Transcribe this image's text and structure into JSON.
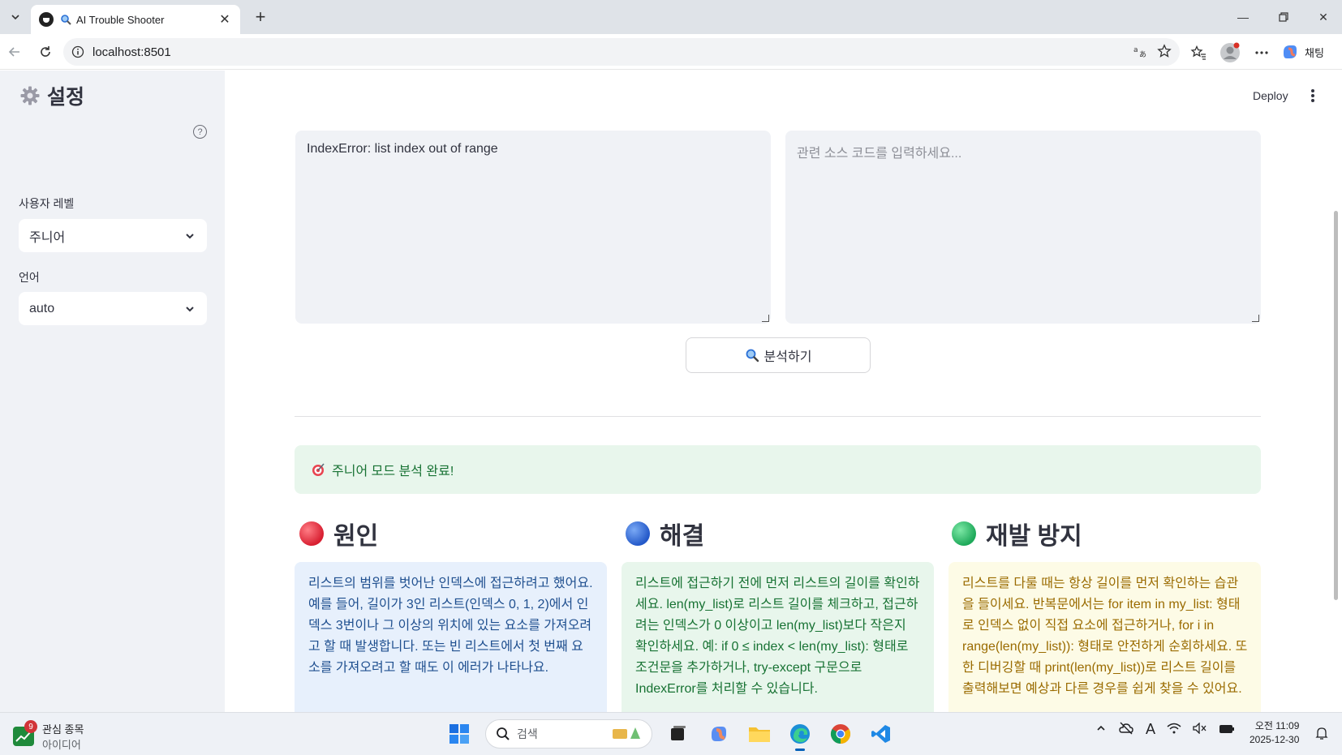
{
  "browser": {
    "tab_title": "AI Trouble Shooter",
    "url": "localhost:8501",
    "chat_label": "채팅"
  },
  "app": {
    "deploy_label": "Deploy",
    "sidebar": {
      "title": "설정",
      "user_level_label": "사용자 레벨",
      "user_level_value": "주니어",
      "language_label": "언어",
      "language_value": "auto"
    },
    "error_input_value": "IndexError: list index out of range",
    "code_input_placeholder": "관련 소스 코드를 입력하세요...",
    "analyze_button": "분석하기",
    "success_message": "주니어 모드 분석 완료!",
    "columns": [
      {
        "title": "원인",
        "dot_color": "#e0303d",
        "bg": "#e7f0fc",
        "text_color": "#1f4f8f",
        "text": "리스트의 범위를 벗어난 인덱스에 접근하려고 했어요. 예를 들어, 길이가 3인 리스트(인덱스 0, 1, 2)에서 인덱스 3번이나 그 이상의 위치에 있는 요소를 가져오려고 할 때 발생합니다. 또는 빈 리스트에서 첫 번째 요소를 가져오려고 할 때도 이 에러가 나타나요."
      },
      {
        "title": "해결",
        "dot_color": "#2f6fd6",
        "bg": "#e8f6ec",
        "text_color": "#177233",
        "text": "리스트에 접근하기 전에 먼저 리스트의 길이를 확인하세요. len(my_list)로 리스트 길이를 체크하고, 접근하려는 인덱스가 0 이상이고 len(my_list)보다 작은지 확인하세요. 예: if 0 ≤ index < len(my_list): 형태로 조건문을 추가하거나, try-except 구문으로 IndexError를 처리할 수 있습니다."
      },
      {
        "title": "재발 방지",
        "dot_color": "#2fbd6a",
        "bg": "#fdfbe6",
        "text_color": "#9a6b00",
        "text": "리스트를 다룰 때는 항상 길이를 먼저 확인하는 습관을 들이세요. 반복문에서는 for item in my_list: 형태로 인덱스 없이 직접 요소에 접근하거나, for i in range(len(my_list)): 형태로 안전하게 순회하세요. 또한 디버깅할 때 print(len(my_list))로 리스트 길이를 출력해보면 예상과 다른 경우를 쉽게 찾을 수 있어요."
      }
    ]
  },
  "taskbar": {
    "stock_badge": "9",
    "stock_title": "관심 종목",
    "stock_sub": "아이디어",
    "search_placeholder": "검색",
    "time": "오전 11:09",
    "date": "2025-12-30"
  }
}
